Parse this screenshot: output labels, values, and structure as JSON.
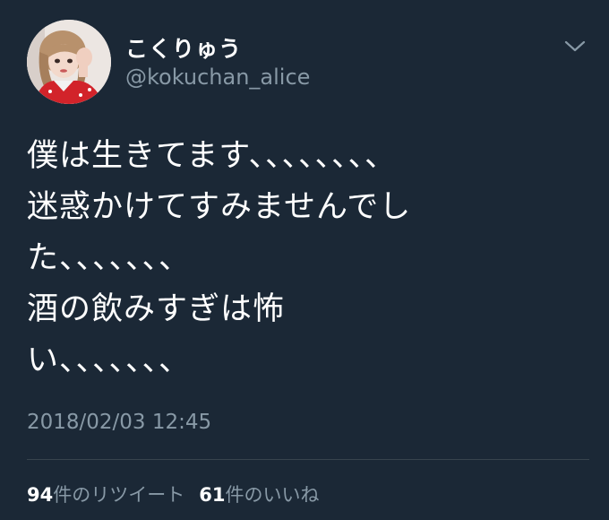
{
  "user": {
    "display_name": "こくりゅう",
    "handle": "@kokuchan_alice"
  },
  "tweet": {
    "lines": [
      "僕は生きてます、、、、、、、、",
      "迷惑かけてすみませんでし",
      "た、、、、、、、",
      "酒の飲みすぎは怖",
      "い、、、、、、、"
    ],
    "timestamp": "2018/02/03 12:45"
  },
  "stats": {
    "retweet_count": "94",
    "retweet_label": "件のリツイート",
    "like_count": "61",
    "like_label": "件のいいね"
  },
  "icons": {
    "menu": "chevron-down-icon",
    "avatar": "profile-photo"
  },
  "colors": {
    "background": "#1b2836",
    "primary_text": "#ffffff",
    "secondary_text": "#8899a6",
    "divider": "#38444d"
  }
}
